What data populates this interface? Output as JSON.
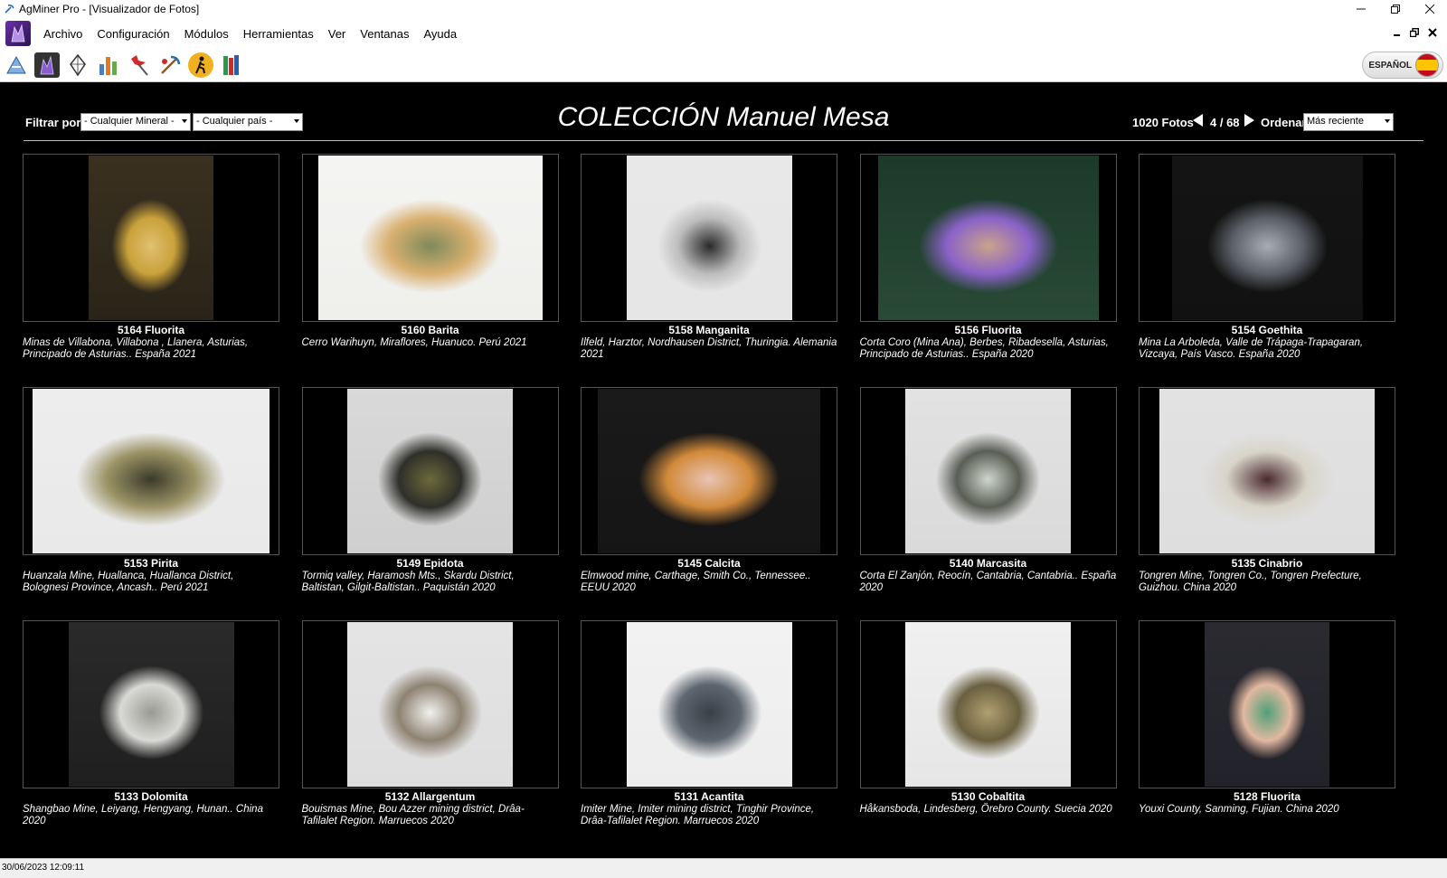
{
  "window": {
    "title": "AgMiner Pro - [Visualizador de Fotos]"
  },
  "menu": [
    "Archivo",
    "Configuración",
    "Módulos",
    "Herramientas",
    "Ver",
    "Ventanas",
    "Ayuda"
  ],
  "toolbar": {
    "icons": [
      "diamond-ruler-icon",
      "crystal-icon",
      "gem-outline-icon",
      "bar-chart-icon",
      "map-pin-icon",
      "miner-icon",
      "hiker-icon",
      "books-icon"
    ],
    "language_label": "ESPAÑOL"
  },
  "viewer": {
    "filter_label": "Filtrar por:",
    "mineral_filter": "- Cualquier Mineral -",
    "country_filter": "- Cualquier país -",
    "collection_title": "COLECCIÓN Manuel Mesa",
    "photo_count": "1020 Fotos",
    "page": "4 / 68",
    "sort_label": "Ordenar por:",
    "sort_value": "Más reciente"
  },
  "cards": [
    {
      "title": "5164  Fluorita",
      "locality": "Minas de Villabona, Villabona , Llanera, Asturias, Principado de Asturias.. España  2021",
      "colors": [
        "#3a3020",
        "#c9a23a",
        "#2a2418"
      ],
      "accent": "#e0c070"
    },
    {
      "title": "5160  Barita",
      "locality": "Cerro Warihuyn, Miraflores, Huanuco. Perú  2021",
      "colors": [
        "#f4f4f2",
        "#d9b070",
        "#efefec"
      ],
      "accent": "#7e8a5a"
    },
    {
      "title": "5158  Manganita",
      "locality": "Ilfeld, Harztor, Nordhausen District, Thuringia. Alemania  2021",
      "colors": [
        "#e8e8e8",
        "#bdbdbd",
        "#e6e6e6"
      ],
      "accent": "#2a2a2a"
    },
    {
      "title": "5156  Fluorita",
      "locality": "Corta Coro (Mina Ana), Berbes, Ribadesella, Asturias, Principado de Asturias.. España  2020",
      "colors": [
        "#1c3a2a",
        "#8a62c8",
        "#294a36"
      ],
      "accent": "#c9a38a"
    },
    {
      "title": "5154  Goethita",
      "locality": "Mina La Arboleda, Valle de Trápaga-Trapagaran, Vizcaya, País Vasco. España  2020",
      "colors": [
        "#141414",
        "#5a5f66",
        "#111111"
      ],
      "accent": "#a9adb3"
    },
    {
      "title": "5153  Pirita",
      "locality": "Huanzala Mine, Huallanca, Huallanca District, Bolognesi Province, Ancash.. Perú  2021",
      "colors": [
        "#ededed",
        "#9c9466",
        "#e9e9e9"
      ],
      "accent": "#3a3a2a"
    },
    {
      "title": "5149  Epidota",
      "locality": "Tormiq valley, Haramosh Mts., Skardu District, Baltistan, Gilgit-Baltistan.. Paquistán  2020",
      "colors": [
        "#d9d9d9",
        "#2f2f2a",
        "#cfcfcf"
      ],
      "accent": "#6b6a3a"
    },
    {
      "title": "5145  Calcita",
      "locality": "Elmwood mine,  Carthage, Smith Co., Tennessee.. EEUU  2020",
      "colors": [
        "#1a1a1a",
        "#d28a3a",
        "#151515"
      ],
      "accent": "#e8c4b4"
    },
    {
      "title": "5140  Marcasita",
      "locality": "Corta El Zanjón, Reocín, Cantabria, Cantabria.. España  2020",
      "colors": [
        "#e2e2e2",
        "#5a5e55",
        "#dadada"
      ],
      "accent": "#cfd6cc"
    },
    {
      "title": "5135  Cinabrio",
      "locality": "Tongren Mine, Tongren Co., Tongren Prefecture, Guizhou. China  2020",
      "colors": [
        "#e2e2e2",
        "#d8d4c8",
        "#dedede"
      ],
      "accent": "#4a2a2e"
    },
    {
      "title": "5133  Dolomita",
      "locality": "Shangbao Mine, Leiyang, Hengyang, Hunan.. China  2020",
      "colors": [
        "#2a2a2a",
        "#d9d9d6",
        "#1f1f1f"
      ],
      "accent": "#9a9a94"
    },
    {
      "title": "5132  Allargentum",
      "locality": "Bouismas Mine, Bou Azzer mining district, Drâa-Tafilalet Region. Marruecos  2020",
      "colors": [
        "#e4e4e4",
        "#8e8272",
        "#dedede"
      ],
      "accent": "#f2f2f0"
    },
    {
      "title": "5131  Acantita",
      "locality": "Imiter Mine, Imiter mining district, Tinghir Province, Drâa-Tafilalet Region. Marruecos  2020",
      "colors": [
        "#f2f2f2",
        "#5e6670",
        "#ededed"
      ],
      "accent": "#3a4048"
    },
    {
      "title": "5130  Cobaltita",
      "locality": "Håkansboda, Lindesberg, Örebro County. Suecia  2020",
      "colors": [
        "#f0f0f0",
        "#6a6040",
        "#e6e6e6"
      ],
      "accent": "#b0a070"
    },
    {
      "title": "5128  Fluorita",
      "locality": "Youxi County, Sanming, Fujian. China  2020",
      "colors": [
        "#2a2a30",
        "#e2b8a0",
        "#22222a"
      ],
      "accent": "#4fa078"
    }
  ],
  "status": {
    "datetime": "30/06/2023 12:09:11"
  }
}
